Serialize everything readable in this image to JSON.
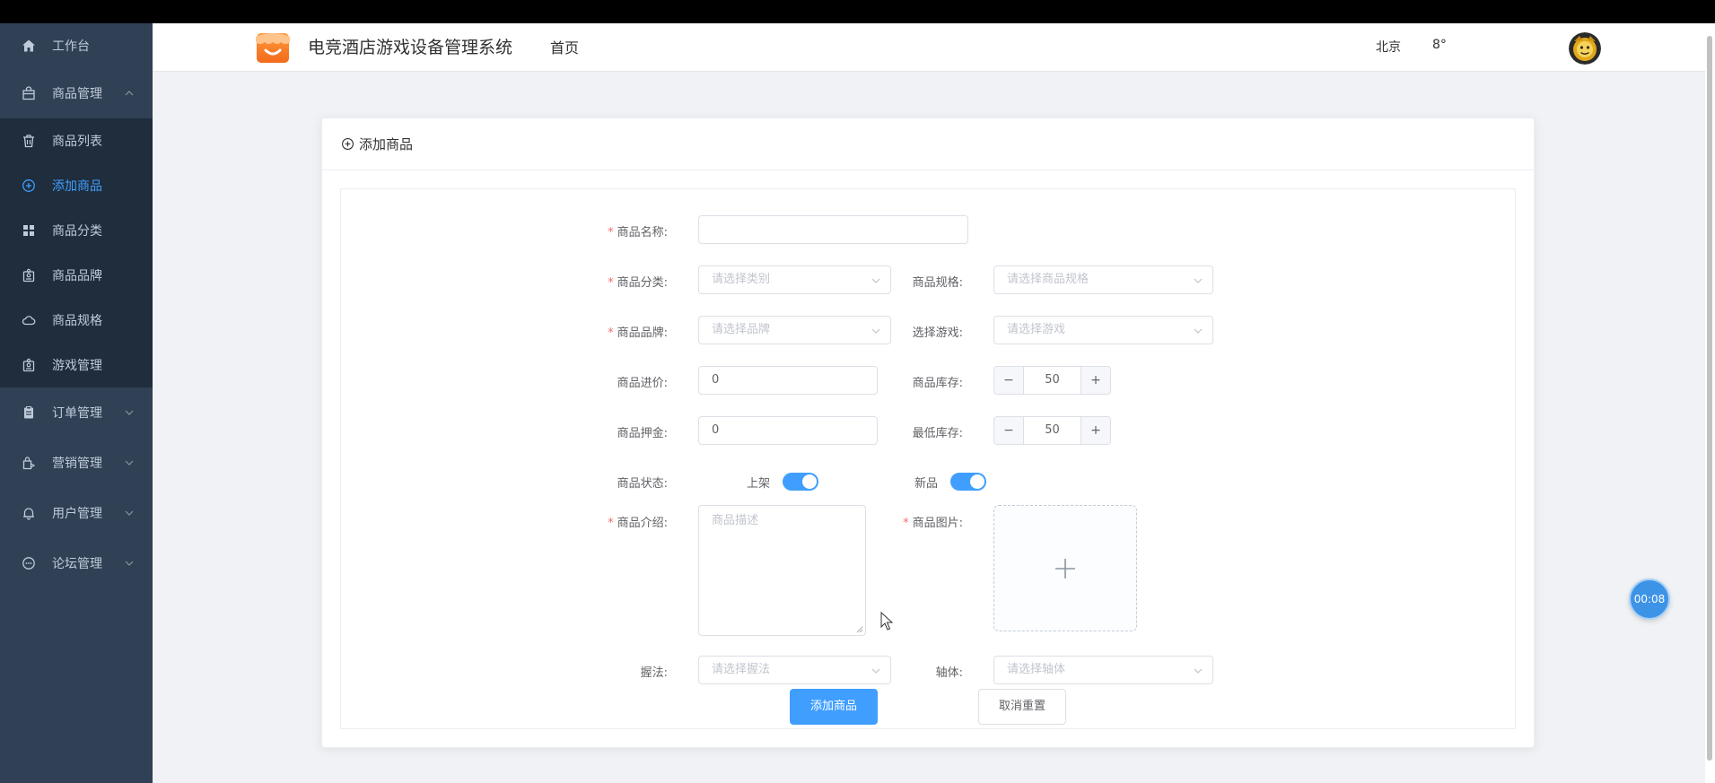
{
  "sidebar": {
    "items": [
      {
        "label": "工作台",
        "icon": "home-icon"
      },
      {
        "label": "商品管理",
        "icon": "bag-icon"
      },
      {
        "label": "商品列表",
        "icon": "trash-icon"
      },
      {
        "label": "添加商品",
        "icon": "circle-plus-icon"
      },
      {
        "label": "商品分类",
        "icon": "grid-icon"
      },
      {
        "label": "商品品牌",
        "icon": "badge-icon"
      },
      {
        "label": "商品规格",
        "icon": "cloud-icon"
      },
      {
        "label": "游戏管理",
        "icon": "badge-icon"
      },
      {
        "label": "订单管理",
        "icon": "clipboard-icon"
      },
      {
        "label": "营销管理",
        "icon": "shopping-icon"
      },
      {
        "label": "用户管理",
        "icon": "bell-icon"
      },
      {
        "label": "论坛管理",
        "icon": "chat-icon"
      }
    ]
  },
  "header": {
    "title": "电竞酒店游戏设备管理系统",
    "home": "首页",
    "city": "北京",
    "temperature": "8°"
  },
  "card": {
    "title": "添加商品"
  },
  "form": {
    "name_label": "商品名称:",
    "name_value": "",
    "category_label": "商品分类:",
    "category_placeholder": "请选择类别",
    "spec_label": "商品规格:",
    "spec_placeholder": "请选择商品规格",
    "brand_label": "商品品牌:",
    "brand_placeholder": "请选择品牌",
    "game_label": "选择游戏:",
    "game_placeholder": "请选择游戏",
    "price_label": "商品进价:",
    "price_value": "0",
    "stock_label": "商品库存:",
    "stock_value": "50",
    "deposit_label": "商品押金:",
    "deposit_value": "0",
    "min_stock_label": "最低库存:",
    "min_stock_value": "50",
    "status_label": "商品状态:",
    "on_shelf_text": "上架",
    "new_text": "新品",
    "intro_label": "商品介绍:",
    "intro_placeholder": "商品描述",
    "image_label": "商品图片:",
    "grip_label": "握法:",
    "grip_placeholder": "请选择握法",
    "shaft_label": "轴体:",
    "shaft_placeholder": "请选择轴体",
    "submit": "添加商品",
    "reset": "取消重置",
    "minus": "−",
    "plus": "+"
  },
  "timer": "00:08",
  "colors": {
    "sidebar_bg": "#304156",
    "sidebar_sub_bg": "#1f2d3d",
    "primary": "#409eff",
    "required": "#f56c6c"
  }
}
